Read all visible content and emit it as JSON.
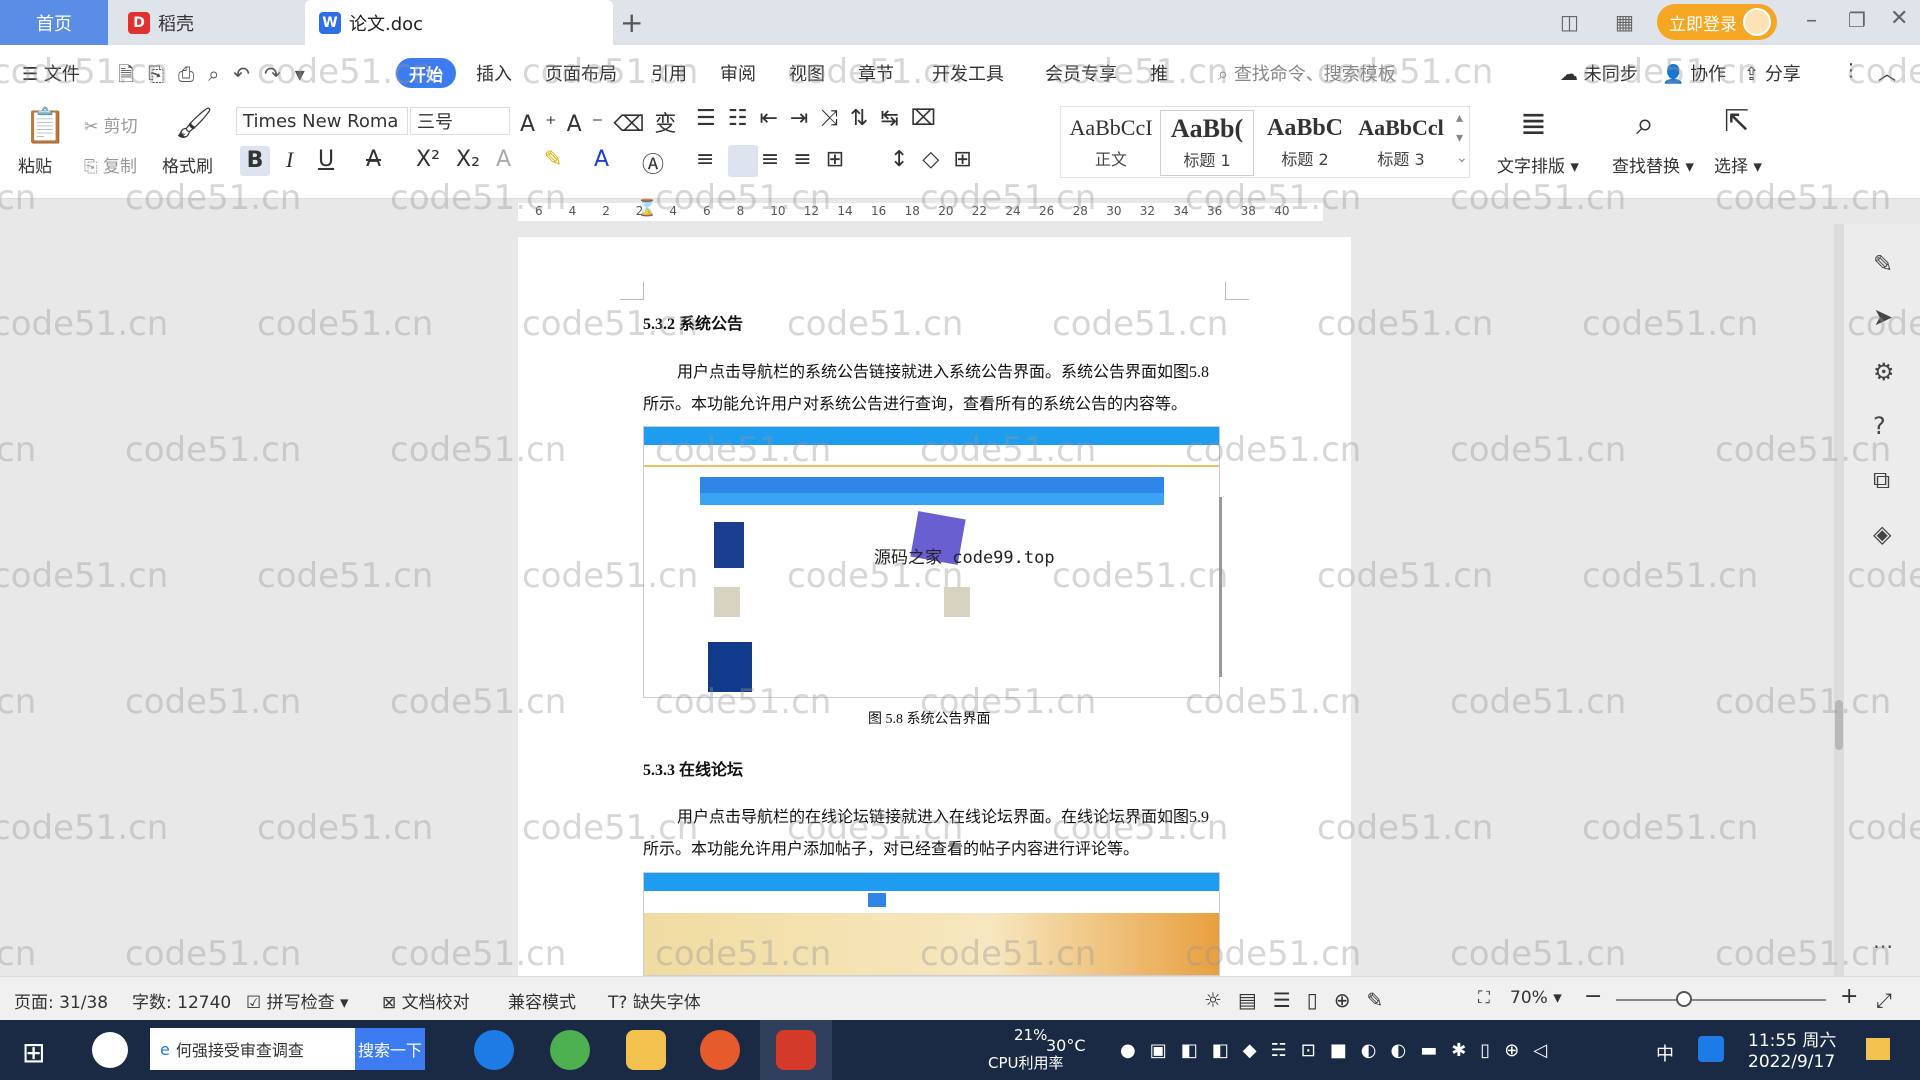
{
  "tabs": {
    "home": "首页",
    "daoke": "稻壳",
    "doc": "论文.doc",
    "login": "立即登录"
  },
  "menu": {
    "file": "文件",
    "items": [
      "开始",
      "插入",
      "页面布局",
      "引用",
      "审阅",
      "视图",
      "章节",
      "开发工具",
      "会员专享",
      "推"
    ],
    "search": "查找命令、搜索模板",
    "sync": "未同步",
    "collab": "协作",
    "share": "分享"
  },
  "ribbon": {
    "paste": "粘贴",
    "cut": "剪切",
    "copy": "复制",
    "format_painter": "格式刷",
    "font_name": "Times New Roma",
    "font_size": "三号",
    "styles": [
      {
        "preview": "AaBbCcI",
        "name": "正文"
      },
      {
        "preview": "AaBb(",
        "name": "标题 1"
      },
      {
        "preview": "AaBbC",
        "name": "标题 2"
      },
      {
        "preview": "AaBbCcl",
        "name": "标题 3"
      }
    ],
    "text_layout": "文字排版",
    "find_replace": "查找替换",
    "select": "选择"
  },
  "ruler": {
    "ticks": [
      "6",
      "4",
      "2",
      "2",
      "4",
      "6",
      "8",
      "10",
      "12",
      "14",
      "16",
      "18",
      "20",
      "22",
      "24",
      "26",
      "28",
      "30",
      "32",
      "34",
      "36",
      "38",
      "40"
    ]
  },
  "document": {
    "h1": "5.3.2  系统公告",
    "p1": "用户点击导航栏的系统公告链接就进入系统公告界面。系统公告界面如图5.8 所示。本功能允许用户对系统公告进行查询，查看所有的系统公告的内容等。",
    "fig1_overlay": "源码之家 code99.top",
    "fig1_caption": "图 5.8  系统公告界面",
    "h2": "5.3.3  在线论坛",
    "p2": "用户点击导航栏的在线论坛链接就进入在线论坛界面。在线论坛界面如图5.9 所示。本功能允许用户添加帖子，对已经查看的帖子内容进行评论等。"
  },
  "watermark": "code51.cn",
  "status": {
    "page": "页面: 31/38",
    "words": "字数: 12740",
    "spell": "拼写检查",
    "proof": "文档校对",
    "compat": "兼容模式",
    "missing_font": "缺失字体",
    "zoom": "70%"
  },
  "taskbar": {
    "search_text": "何强接受审查调查",
    "search_btn": "搜索一下",
    "cpu": "21%",
    "cpu_label": "CPU利用率",
    "temp": "30°C",
    "ime": "中",
    "time": "11:55 周六",
    "date": "2022/9/17"
  },
  "colors": {
    "accent": "#3d7bf0",
    "login": "#f5a623",
    "home_tab": "#5a8de6",
    "taskbar": "#1a2a44"
  }
}
